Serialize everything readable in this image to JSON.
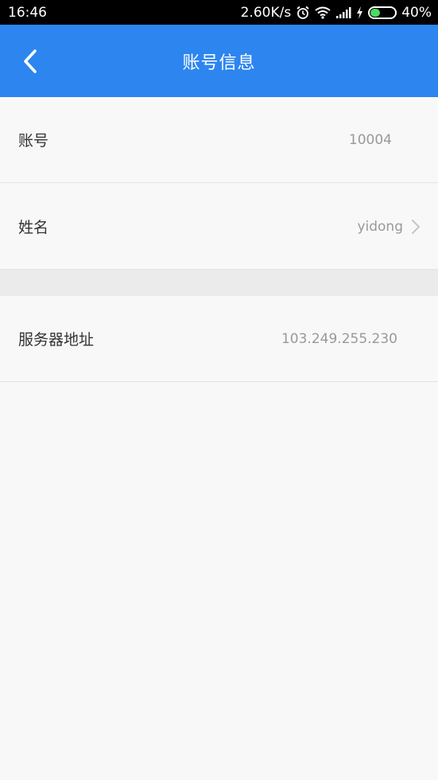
{
  "status_bar": {
    "time": "16:46",
    "net_speed": "2.60K/s",
    "battery_percent": "40%",
    "battery_level": 0.4,
    "icons": [
      "alarm-icon",
      "wifi-icon",
      "signal-icon",
      "charging-icon",
      "battery-icon"
    ]
  },
  "app_bar": {
    "title": "账号信息",
    "back_icon": "chevron-left-icon",
    "color": "#2d85f0"
  },
  "rows": {
    "account": {
      "label": "账号",
      "value": "10004"
    },
    "name": {
      "label": "姓名",
      "value": "yidong",
      "chevron_icon": "chevron-right-icon"
    },
    "server": {
      "label": "服务器地址",
      "value": "103.249.255.230"
    }
  }
}
